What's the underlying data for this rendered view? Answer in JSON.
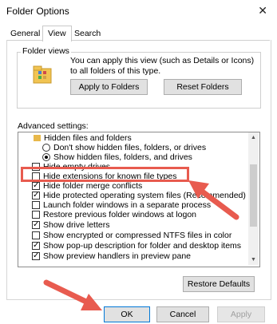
{
  "window": {
    "title": "Folder Options",
    "close_glyph": "✕"
  },
  "tabs": [
    {
      "label": "General"
    },
    {
      "label": "View"
    },
    {
      "label": "Search"
    }
  ],
  "folder_views": {
    "label": "Folder views",
    "description": "You can apply this view (such as Details or Icons) to all folders of this type.",
    "apply_button": "Apply to Folders",
    "reset_button": "Reset Folders"
  },
  "advanced": {
    "label": "Advanced settings:",
    "items": [
      {
        "kind": "folder",
        "label": "Hidden files and folders"
      },
      {
        "kind": "radio",
        "checked": false,
        "label": "Don't show hidden files, folders, or drives"
      },
      {
        "kind": "radio",
        "checked": true,
        "label": "Show hidden files, folders, and drives"
      },
      {
        "kind": "checkbox",
        "checked": false,
        "label": "Hide empty drives"
      },
      {
        "kind": "checkbox",
        "checked": false,
        "label": "Hide extensions for known file types"
      },
      {
        "kind": "checkbox",
        "checked": true,
        "label": "Hide folder merge conflicts"
      },
      {
        "kind": "checkbox",
        "checked": true,
        "label": "Hide protected operating system files (Recommended)"
      },
      {
        "kind": "checkbox",
        "checked": false,
        "label": "Launch folder windows in a separate process"
      },
      {
        "kind": "checkbox",
        "checked": false,
        "label": "Restore previous folder windows at logon"
      },
      {
        "kind": "checkbox",
        "checked": true,
        "label": "Show drive letters"
      },
      {
        "kind": "checkbox",
        "checked": false,
        "label": "Show encrypted or compressed NTFS files in color"
      },
      {
        "kind": "checkbox",
        "checked": true,
        "label": "Show pop-up description for folder and desktop items"
      },
      {
        "kind": "checkbox",
        "checked": true,
        "label": "Show preview handlers in preview pane"
      }
    ]
  },
  "buttons": {
    "restore_defaults": "Restore Defaults",
    "ok": "OK",
    "cancel": "Cancel",
    "apply": "Apply"
  },
  "colors": {
    "annotation": "#e85b4f",
    "button_face": "#e1e1e1",
    "focus_border": "#0078d7"
  }
}
